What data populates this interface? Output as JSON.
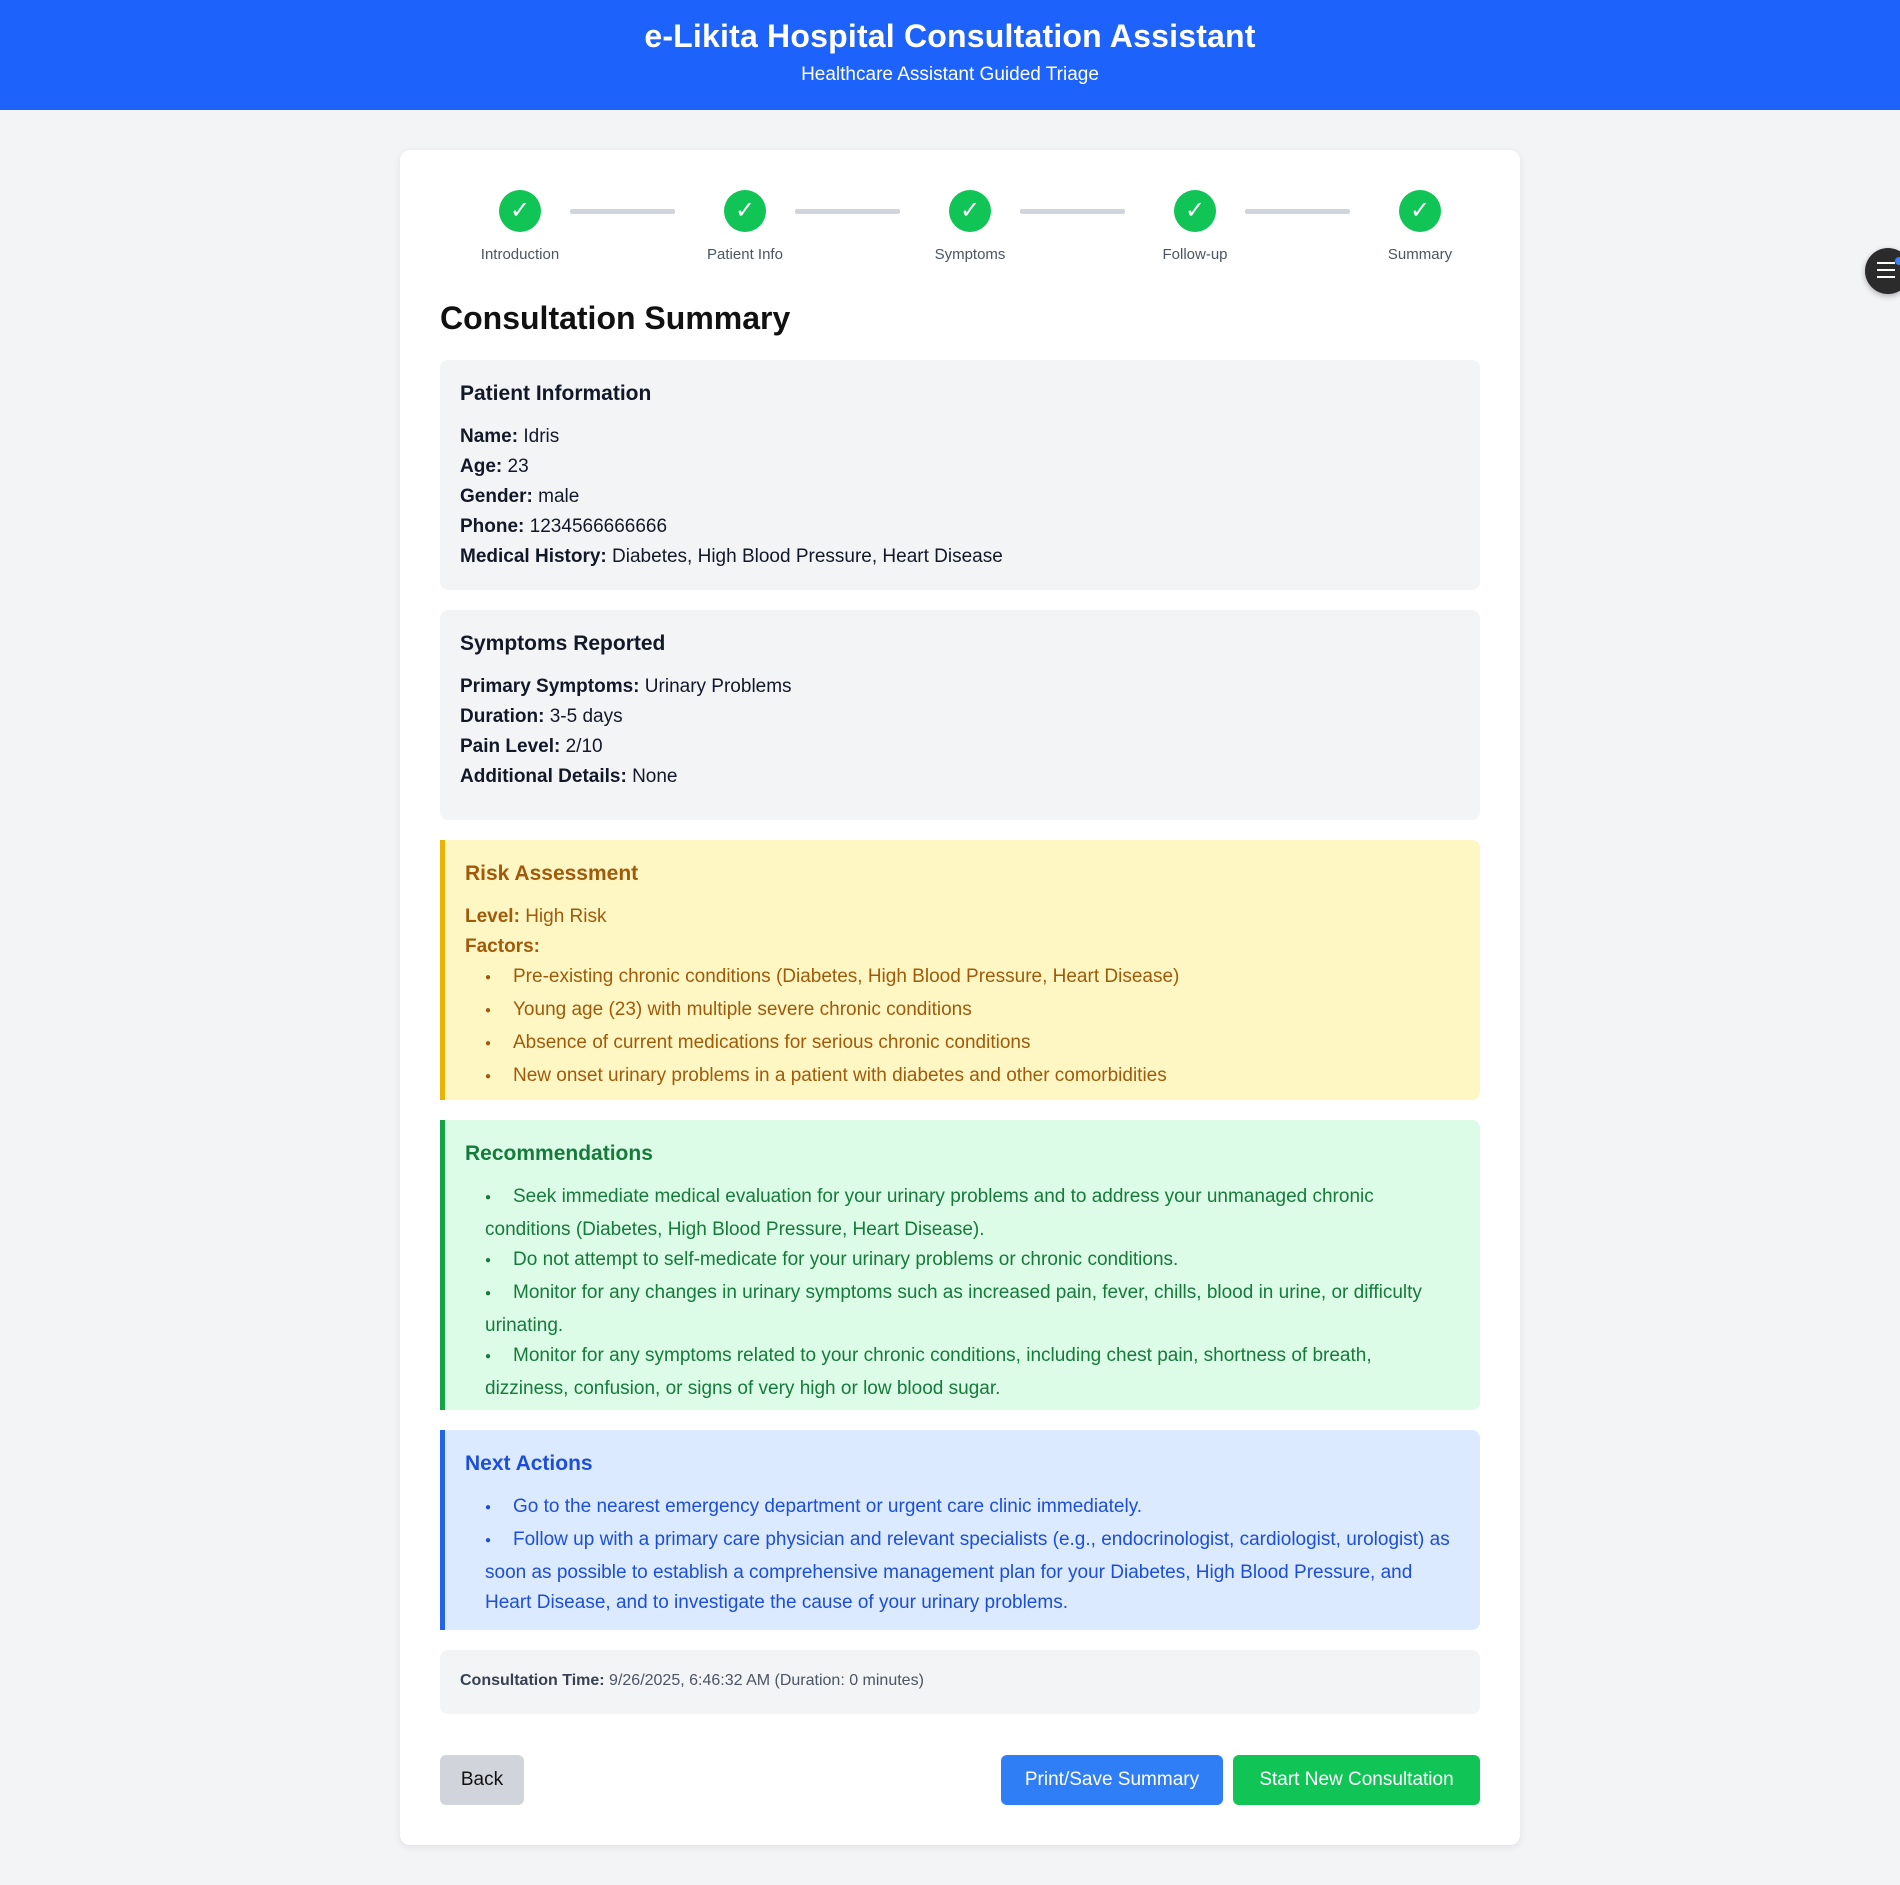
{
  "header": {
    "title": "e-Likita Hospital Consultation Assistant",
    "subtitle": "Healthcare Assistant Guided Triage"
  },
  "steps": [
    {
      "label": "Introduction",
      "icon": "check-icon",
      "status": "complete"
    },
    {
      "label": "Patient Info",
      "icon": "check-icon",
      "status": "complete"
    },
    {
      "label": "Symptoms",
      "icon": "check-icon",
      "status": "complete"
    },
    {
      "label": "Follow-up",
      "icon": "check-icon",
      "status": "complete"
    },
    {
      "label": "Summary",
      "icon": "check-icon",
      "status": "complete"
    }
  ],
  "check_glyph": "✓",
  "page_title": "Consultation Summary",
  "patient": {
    "heading": "Patient Information",
    "name_label": "Name:",
    "name": "Idris",
    "age_label": "Age:",
    "age": "23",
    "gender_label": "Gender:",
    "gender": "male",
    "phone_label": "Phone:",
    "phone": "1234566666666",
    "history_label": "Medical History:",
    "history": "Diabetes, High Blood Pressure, Heart Disease"
  },
  "symptoms": {
    "heading": "Symptoms Reported",
    "primary_label": "Primary Symptoms:",
    "primary": "Urinary Problems",
    "duration_label": "Duration:",
    "duration": "3-5 days",
    "pain_label": "Pain Level:",
    "pain": "2/10",
    "details_label": "Additional Details:",
    "details": "None"
  },
  "risk": {
    "heading": "Risk Assessment",
    "level_label": "Level:",
    "level": "High Risk",
    "factors_label": "Factors:",
    "factors": [
      "Pre-existing chronic conditions (Diabetes, High Blood Pressure, Heart Disease)",
      "Young age (23) with multiple severe chronic conditions",
      "Absence of current medications for serious chronic conditions",
      "New onset urinary problems in a patient with diabetes and other comorbidities"
    ]
  },
  "recommendations": {
    "heading": "Recommendations",
    "items": [
      "Seek immediate medical evaluation for your urinary problems and to address your unmanaged chronic conditions (Diabetes, High Blood Pressure, Heart Disease).",
      "Do not attempt to self-medicate for your urinary problems or chronic conditions.",
      "Monitor for any changes in urinary symptoms such as increased pain, fever, chills, blood in urine, or difficulty urinating.",
      "Monitor for any symptoms related to your chronic conditions, including chest pain, shortness of breath, dizziness, confusion, or signs of very high or low blood sugar."
    ]
  },
  "next_actions": {
    "heading": "Next Actions",
    "items": [
      "Go to the nearest emergency department or urgent care clinic immediately.",
      "Follow up with a primary care physician and relevant specialists (e.g., endocrinologist, cardiologist, urologist) as soon as possible to establish a comprehensive management plan for your Diabetes, High Blood Pressure, and Heart Disease, and to investigate the cause of your urinary problems."
    ]
  },
  "consultation_time": {
    "label": "Consultation Time:",
    "value": "9/26/2025, 6:46:32 AM (Duration: 0 minutes)"
  },
  "buttons": {
    "back": "Back",
    "print": "Print/Save Summary",
    "new": "Start New Consultation"
  },
  "colors": {
    "header_bg": "#1d63fb",
    "step_complete": "#10c456",
    "risk_accent": "#eab308",
    "recommend_accent": "#16a34a",
    "next_accent": "#2563eb"
  },
  "floating_button_icon": "menu-icon"
}
